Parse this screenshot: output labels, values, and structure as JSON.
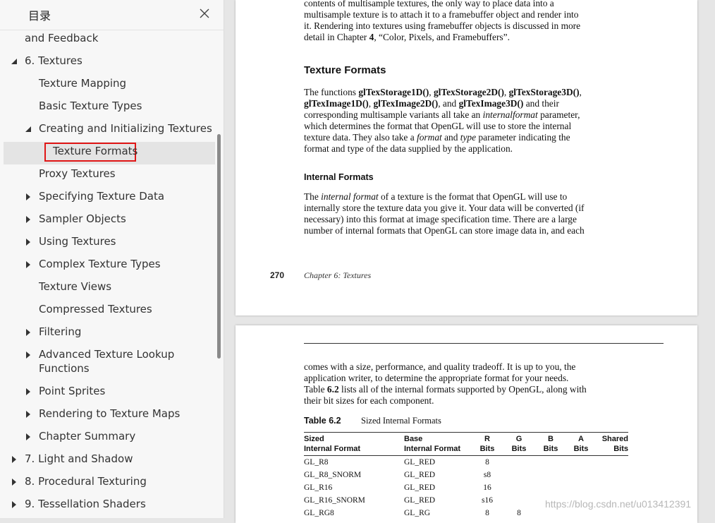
{
  "sidebar": {
    "title": "目录",
    "items": [
      {
        "label": "and Feedback",
        "expander": "none"
      },
      {
        "label": "6. Textures",
        "expander": "expanded"
      },
      {
        "label": "Texture Mapping",
        "expander": "none"
      },
      {
        "label": "Basic Texture Types",
        "expander": "none"
      },
      {
        "label": "Creating and Initializing Textures",
        "expander": "expanded"
      },
      {
        "label": "Texture Formats",
        "expander": "none",
        "selected": true
      },
      {
        "label": "Proxy Textures",
        "expander": "none"
      },
      {
        "label": "Specifying Texture Data",
        "expander": "collapsed"
      },
      {
        "label": "Sampler Objects",
        "expander": "collapsed"
      },
      {
        "label": "Using Textures",
        "expander": "collapsed"
      },
      {
        "label": "Complex Texture Types",
        "expander": "collapsed"
      },
      {
        "label": "Texture Views",
        "expander": "none"
      },
      {
        "label": "Compressed Textures",
        "expander": "none"
      },
      {
        "label": "Filtering",
        "expander": "collapsed"
      },
      {
        "label": "Advanced Texture Lookup",
        "label2": "Functions",
        "expander": "collapsed"
      },
      {
        "label": "Point Sprites",
        "expander": "collapsed"
      },
      {
        "label": "Rendering to Texture Maps",
        "expander": "collapsed"
      },
      {
        "label": "Chapter Summary",
        "expander": "collapsed"
      },
      {
        "label": "7. Light and Shadow",
        "expander": "collapsed"
      },
      {
        "label": "8. Procedural Texturing",
        "expander": "collapsed"
      },
      {
        "label": "9. Tessellation Shaders",
        "expander": "collapsed"
      }
    ]
  },
  "page1": {
    "top_lines": [
      "contents of multisample textures, the only way to place data into a",
      "multisample texture is to attach it to a framebuffer object and render into",
      "it. Rendering into textures using framebuffer objects is discussed in more",
      "detail in Chapter"
    ],
    "top_chapter_ref": "4",
    "top_chapter_title": "“Color, Pixels, and Framebuffers”.",
    "heading_texture_formats": "Texture Formats",
    "p1": {
      "t1": "The functions ",
      "f1": "glTexStorage1D()",
      "f2": "glTexStorage2D()",
      "f3": "glTexStorage3D()",
      "f4": "glTexImage1D()",
      "f5": "glTexImage2D()",
      "f6": "glTexImage3D()",
      "t_and": "and",
      "t2": " and their",
      "t3": "corresponding multisample variants all take an ",
      "i1": "internalformat",
      "t4": " parameter,",
      "t5": "which determines the format that OpenGL will use to store the internal",
      "t6": "texture data. They also take a ",
      "i2": "format",
      "t7": " and ",
      "i3": "type",
      "t8": " parameter indicating the",
      "t9": "format and type of the data supplied by the application."
    },
    "heading_internal_formats": "Internal Formats",
    "p2": {
      "t1": "The ",
      "i1": "internal format",
      "t2": " of a texture is the format that OpenGL will use to",
      "l2": "internally store the texture data you give it. Your data will be converted (if",
      "l3": "necessary) into this format at image specification time. There are a large",
      "l4": "number of internal formats that OpenGL can store image data in, and each"
    },
    "footer_page": "270",
    "footer_chapter": "Chapter 6: Textures"
  },
  "page2": {
    "lines": [
      "comes with a size, performance, and quality tradeoff. It is up to you, the",
      "application writer, to determine the appropriate format for your needs."
    ],
    "l3_a": "Table ",
    "l3_b": "6.2",
    "l3_c": " lists all of the internal formats supported by OpenGL, along with",
    "l4": "their bit sizes for each component.",
    "table_label": "Table 6.2",
    "table_title": "Sized Internal Formats",
    "columns": [
      {
        "l1": "Sized",
        "l2": "Internal Format"
      },
      {
        "l1": "Base",
        "l2": "Internal Format"
      },
      {
        "l1": "R",
        "l2": "Bits"
      },
      {
        "l1": "G",
        "l2": "Bits"
      },
      {
        "l1": "B",
        "l2": "Bits"
      },
      {
        "l1": "A",
        "l2": "Bits"
      },
      {
        "l1": "Shared",
        "l2": "Bits"
      }
    ],
    "rows": [
      [
        "GL_R8",
        "GL_RED",
        "8",
        "",
        "",
        "",
        ""
      ],
      [
        "GL_R8_SNORM",
        "GL_RED",
        "s8",
        "",
        "",
        "",
        ""
      ],
      [
        "GL_R16",
        "GL_RED",
        "16",
        "",
        "",
        "",
        ""
      ],
      [
        "GL_R16_SNORM",
        "GL_RED",
        "s16",
        "",
        "",
        "",
        ""
      ],
      [
        "GL_RG8",
        "GL_RG",
        "8",
        "8",
        "",
        "",
        ""
      ]
    ]
  },
  "watermark": "https://blog.csdn.net/u013412391",
  "colors": {
    "selection_border": "#e01616",
    "selection_bg": "#e4e4e4",
    "sidebar_bg": "#f7f7f7",
    "canvas_bg": "#e6e6e6"
  }
}
